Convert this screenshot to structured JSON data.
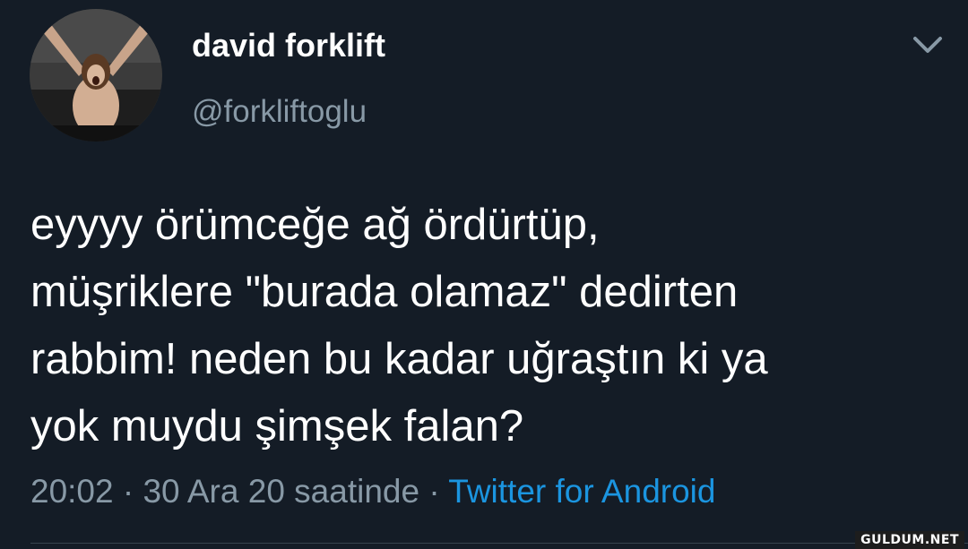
{
  "tweet": {
    "display_name": "david forklift",
    "handle": "@forkliftoglu",
    "text_lines": [
      "eyyyy örümceğe ağ ördürtüp,",
      "müşriklere \"burada olamaz\" dedirten",
      "rabbim! neden bu kadar uğraştın ki ya",
      "yok muydu şimşek falan?"
    ],
    "time": "20:02",
    "separator": " · ",
    "date": "30 Ara 20 saatinde",
    "source": "Twitter for Android"
  },
  "icons": {
    "menu": "chevron-down-icon",
    "avatar": "profile-photo"
  },
  "colors": {
    "background": "#141c26",
    "text": "#ffffff",
    "secondary": "#8899a6",
    "link": "#1b95e0"
  },
  "watermark": "GULDUM.NET"
}
